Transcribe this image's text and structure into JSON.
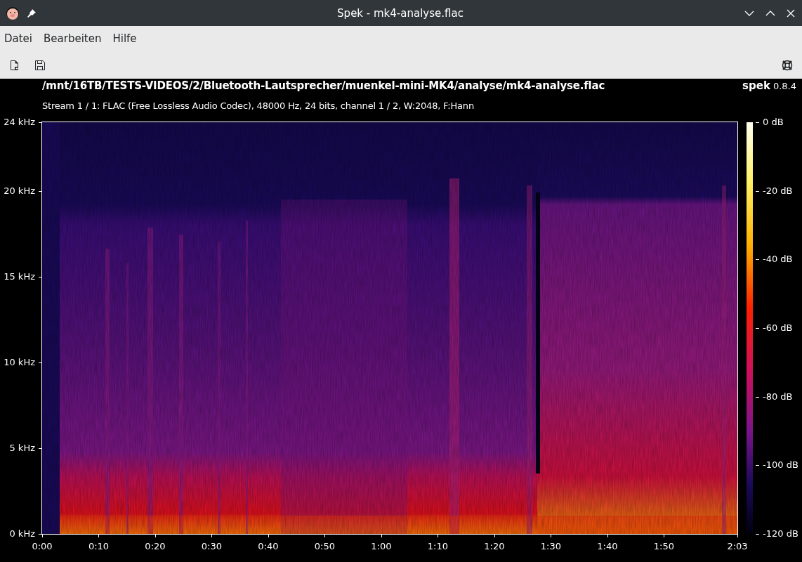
{
  "window": {
    "title": "Spek - mk4-analyse.flac"
  },
  "menu": [
    "Datei",
    "Bearbeiten",
    "Hilfe"
  ],
  "header": {
    "path": "/mnt/16TB/TESTS-VIDEOS/2/Bluetooth-Lautsprecher/muenkel-mini-MK4/analyse/mk4-analyse.flac",
    "app_name": "spek",
    "version": "0.8.4",
    "stream_info": "Stream 1 / 1: FLAC (Free Lossless Audio Codec), 48000 Hz, 24 bits, channel 1 / 2, W:2048, F:Hann"
  },
  "frequency_axis": [
    "24 kHz",
    "20 kHz",
    "15 kHz",
    "10 kHz",
    "5 kHz",
    "0 kHz"
  ],
  "time_axis": [
    "0:00",
    "0:10",
    "0:20",
    "0:30",
    "0:40",
    "0:50",
    "1:00",
    "1:10",
    "1:20",
    "1:30",
    "1:40",
    "1:50",
    "2:03"
  ],
  "level_scale": [
    "0 dB",
    "-20 dB",
    "-40 dB",
    "-60 dB",
    "-80 dB",
    "-100 dB",
    "-120 dB"
  ]
}
